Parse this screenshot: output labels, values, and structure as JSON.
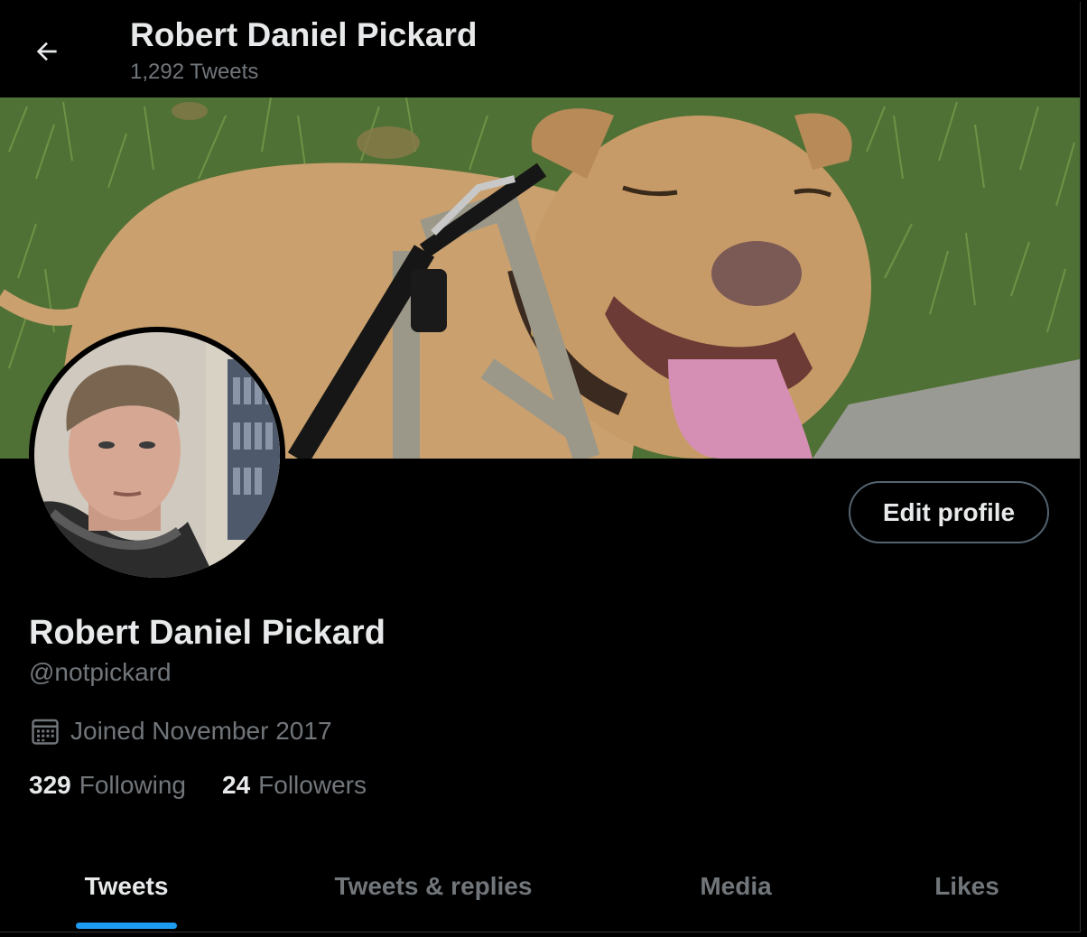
{
  "header": {
    "back_label": "Back",
    "title": "Robert Daniel Pickard",
    "tweet_count": "1,292 Tweets"
  },
  "banner": {
    "subject": "dog-photo"
  },
  "profile": {
    "edit_label": "Edit profile",
    "display_name": "Robert Daniel Pickard",
    "handle": "@notpickard",
    "joined": "Joined November 2017",
    "following_count": "329",
    "following_label": "Following",
    "followers_count": "24",
    "followers_label": "Followers"
  },
  "tabs": [
    {
      "label": "Tweets",
      "active": true
    },
    {
      "label": "Tweets & replies",
      "active": false
    },
    {
      "label": "Media",
      "active": false
    },
    {
      "label": "Likes",
      "active": false
    }
  ],
  "colors": {
    "background": "#000000",
    "text_primary": "#e7e9ea",
    "text_secondary": "#71767b",
    "accent": "#1d9bf0",
    "border": "#536471"
  },
  "icons": {
    "back": "arrow-left-icon",
    "calendar": "calendar-icon"
  }
}
